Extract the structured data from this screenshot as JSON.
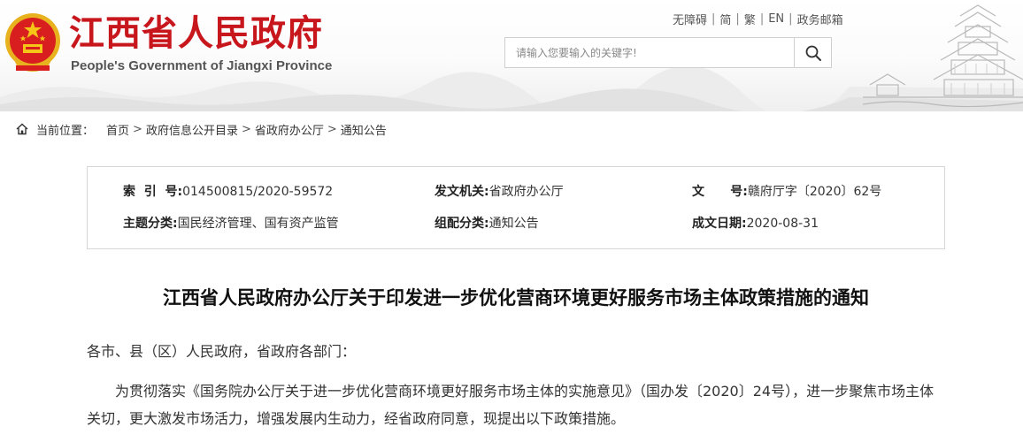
{
  "header": {
    "site_title": "江西省人民政府",
    "site_subtitle": "People's Government of Jiangxi Province",
    "top_links": [
      "无障碍",
      "简",
      "繁",
      "EN",
      "政务邮箱"
    ],
    "search": {
      "placeholder": "请输入您要输入的关键字!"
    },
    "colors": {
      "brand_red": "#c8161d"
    }
  },
  "breadcrumb": {
    "label": "当前位置：",
    "items": [
      "首页",
      "政府信息公开目录",
      "省政府办公厅",
      "通知公告"
    ],
    "separator": ">"
  },
  "meta": {
    "index_no": {
      "label": "索  引  号:",
      "value": "014500815/2020-59572"
    },
    "issuer": {
      "label": "发文机关:",
      "value": "省政府办公厅"
    },
    "doc_no": {
      "label": "文      号:",
      "value": "赣府厅字〔2020〕62号"
    },
    "topic": {
      "label": "主题分类:",
      "value": "国民经济管理、国有资产监管"
    },
    "category": {
      "label": "组配分类:",
      "value": "通知公告"
    },
    "date": {
      "label": "成文日期:",
      "value": "2020-08-31"
    }
  },
  "article": {
    "title": "江西省人民政府办公厅关于印发进一步优化营商环境更好服务市场主体政策措施的通知",
    "salutation": "各市、县（区）人民政府，省政府各部门：",
    "paragraph1": "为贯彻落实《国务院办公厅关于进一步优化营商环境更好服务市场主体的实施意见》（国办发〔2020〕24号），进一步聚焦市场主体关切，更大激发市场活力，增强发展内生动力，经省政府同意，现提出以下政策措施。"
  }
}
